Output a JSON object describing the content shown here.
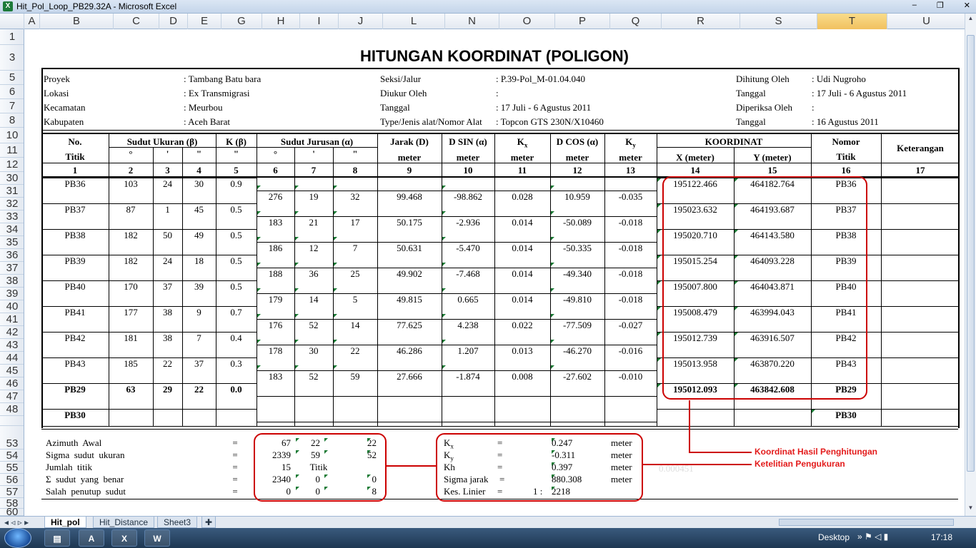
{
  "window": {
    "title": "Hit_Pol_Loop_PB29.32A - Microsoft Excel",
    "controls": [
      "–",
      "❐",
      "✕"
    ]
  },
  "columns": [
    {
      "l": "A"
    },
    {
      "l": "B"
    },
    {
      "l": "C"
    },
    {
      "l": "D"
    },
    {
      "l": "E"
    },
    {
      "l": "G"
    },
    {
      "l": "H"
    },
    {
      "l": "I"
    },
    {
      "l": "J"
    },
    {
      "l": "L"
    },
    {
      "l": "N"
    },
    {
      "l": "O"
    },
    {
      "l": "P"
    },
    {
      "l": "Q"
    },
    {
      "l": "R"
    },
    {
      "l": "S"
    },
    {
      "l": "T"
    },
    {
      "l": "U"
    }
  ],
  "rows": [
    "1",
    "3",
    "5",
    "6",
    "7",
    "8",
    "10",
    "11",
    "12",
    "30",
    "31",
    "32",
    "33",
    "34",
    "35",
    "36",
    "37",
    "38",
    "39",
    "40",
    "41",
    "42",
    "43",
    "44",
    "45",
    "46",
    "47",
    "48",
    "",
    "53",
    "54",
    "55",
    "56",
    "57",
    "58",
    "60"
  ],
  "sheet_title": "HITUNGAN KOORDINAT (POLIGON)",
  "info": {
    "labels1": [
      "Proyek",
      "Lokasi",
      "Kecamatan",
      "Kabupaten"
    ],
    "values1": [
      ": Tambang Batu bara",
      ": Ex Transmigrasi",
      ": Meurbou",
      ": Aceh Barat"
    ],
    "labels2": [
      "Seksi/Jalur",
      "Diukur Oleh",
      "Tanggal",
      "Type/Jenis alat/Nomor Alat"
    ],
    "values2": [
      ": P.39-Pol_M-01.04.040",
      ":",
      ": 17 Juli - 6 Agustus 2011",
      ": Topcon GTS 230N/X10460"
    ],
    "labels3": [
      "Dihitung Oleh",
      "Tanggal",
      "Diperiksa Oleh",
      "Tanggal"
    ],
    "values3": [
      ": Udi Nugroho",
      ": 17 Juli - 6 Agustus 2011",
      ":",
      ": 16 Agustus 2011"
    ]
  },
  "headers": {
    "no": "No.",
    "titik": "Titik",
    "sudut_ukuran": "Sudut Ukuran (β)",
    "k_beta": "K (β)",
    "sudut_jurusan": "Sudut Jurusan (α)",
    "jarak": "Jarak (D)",
    "dsin": "D SIN (α)",
    "kx": "K",
    "kx_sub": "x",
    "dcos": "D COS (α)",
    "ky": "K",
    "ky_sub": "y",
    "koordinat": "KOORDINAT",
    "nomor": "Nomor",
    "keterangan": "Keterangan",
    "deg": "°",
    "min": "'",
    "sec": "\"",
    "meter": "meter",
    "xm": "X (meter)",
    "ym": "Y (meter)",
    "nums": [
      "1",
      "2",
      "3",
      "4",
      "5",
      "6",
      "7",
      "8",
      "9",
      "10",
      "11",
      "12",
      "13",
      "14",
      "15",
      "16",
      "17"
    ]
  },
  "stations": [
    {
      "name": "PB36",
      "d": "103",
      "m": "24",
      "s": "30",
      "k": "0.9",
      "x": "195122.466",
      "y": "464182.764",
      "nomor": "PB36"
    },
    {
      "name": "PB37",
      "d": "87",
      "m": "1",
      "s": "45",
      "k": "0.5",
      "x": "195023.632",
      "y": "464193.687",
      "nomor": "PB37"
    },
    {
      "name": "PB38",
      "d": "182",
      "m": "50",
      "s": "49",
      "k": "0.5",
      "x": "195020.710",
      "y": "464143.580",
      "nomor": "PB38"
    },
    {
      "name": "PB39",
      "d": "182",
      "m": "24",
      "s": "18",
      "k": "0.5",
      "x": "195015.254",
      "y": "464093.228",
      "nomor": "PB39"
    },
    {
      "name": "PB40",
      "d": "170",
      "m": "37",
      "s": "39",
      "k": "0.5",
      "x": "195007.800",
      "y": "464043.871",
      "nomor": "PB40"
    },
    {
      "name": "PB41",
      "d": "177",
      "m": "38",
      "s": "9",
      "k": "0.7",
      "x": "195008.479",
      "y": "463994.043",
      "nomor": "PB41"
    },
    {
      "name": "PB42",
      "d": "181",
      "m": "38",
      "s": "7",
      "k": "0.4",
      "x": "195012.739",
      "y": "463916.507",
      "nomor": "PB42"
    },
    {
      "name": "PB43",
      "d": "185",
      "m": "22",
      "s": "37",
      "k": "0.3",
      "x": "195013.958",
      "y": "463870.220",
      "nomor": "PB43"
    },
    {
      "name": "PB29",
      "d": "63",
      "m": "29",
      "s": "22",
      "k": "0.0",
      "x": "195012.093",
      "y": "463842.608",
      "nomor": "PB29"
    },
    {
      "name": "PB30",
      "d": "",
      "m": "",
      "s": "",
      "k": "",
      "x": "",
      "y": "",
      "nomor": "PB30"
    }
  ],
  "legs": [
    {
      "ad": "276",
      "am": "19",
      "as": "32",
      "D": "99.468",
      "dsin": "-98.862",
      "kx": "0.028",
      "dcos": "10.959",
      "ky": "-0.035"
    },
    {
      "ad": "183",
      "am": "21",
      "as": "17",
      "D": "50.175",
      "dsin": "-2.936",
      "kx": "0.014",
      "dcos": "-50.089",
      "ky": "-0.018"
    },
    {
      "ad": "186",
      "am": "12",
      "as": "7",
      "D": "50.631",
      "dsin": "-5.470",
      "kx": "0.014",
      "dcos": "-50.335",
      "ky": "-0.018"
    },
    {
      "ad": "188",
      "am": "36",
      "as": "25",
      "D": "49.902",
      "dsin": "-7.468",
      "kx": "0.014",
      "dcos": "-49.340",
      "ky": "-0.018"
    },
    {
      "ad": "179",
      "am": "14",
      "as": "5",
      "D": "49.815",
      "dsin": "0.665",
      "kx": "0.014",
      "dcos": "-49.810",
      "ky": "-0.018"
    },
    {
      "ad": "176",
      "am": "52",
      "as": "14",
      "D": "77.625",
      "dsin": "4.238",
      "kx": "0.022",
      "dcos": "-77.509",
      "ky": "-0.027"
    },
    {
      "ad": "178",
      "am": "30",
      "as": "22",
      "D": "46.286",
      "dsin": "1.207",
      "kx": "0.013",
      "dcos": "-46.270",
      "ky": "-0.016"
    },
    {
      "ad": "183",
      "am": "52",
      "as": "59",
      "D": "27.666",
      "dsin": "-1.874",
      "kx": "0.008",
      "dcos": "-27.602",
      "ky": "-0.010"
    }
  ],
  "summary": {
    "rows": [
      {
        "label": "Azimuth  Awal",
        "eq": "=",
        "a": "67",
        "b": "22",
        "c": "22"
      },
      {
        "label": "Sigma  sudut  ukuran",
        "eq": "=",
        "a": "2339",
        "b": "59",
        "c": "52"
      },
      {
        "label": "Jumlah  titik",
        "eq": "=",
        "a": "15",
        "b": "Titik",
        "c": ""
      },
      {
        "label": "Σ  sudut  yang  benar",
        "eq": "=",
        "a": "2340",
        "b": "0",
        "c": "0"
      },
      {
        "label": "Salah  penutup  sudut",
        "eq": "=",
        "a": "0",
        "b": "0",
        "c": "8"
      }
    ],
    "right": [
      {
        "label": "K",
        "sub": "x",
        "eq": "=",
        "val": "0.247",
        "unit": "meter"
      },
      {
        "label": "K",
        "sub": "y",
        "eq": "=",
        "val": "-0.311",
        "unit": "meter"
      },
      {
        "label": "Kh",
        "sub": "",
        "eq": "=",
        "val": "0.397",
        "unit": "meter"
      },
      {
        "label": "Sigma jarak",
        "sub": "",
        "eq": "=",
        "val": "880.308",
        "unit": "meter"
      },
      {
        "label": "Kes. Linier",
        "sub": "",
        "eq": "=",
        "val": "2218",
        "unit": "",
        "prefix": "1 :"
      }
    ],
    "faint": "0.000451"
  },
  "annotations": {
    "coord": "Koordinat Hasil Penghitungan",
    "accuracy": "Ketelitian Pengukuran"
  },
  "tabs": [
    "Hit_pol",
    "Hit_Distance",
    "Sheet3"
  ],
  "taskbar": {
    "desktop": "Desktop",
    "time": "17:18",
    "apps": [
      "A",
      "X",
      "W"
    ]
  }
}
